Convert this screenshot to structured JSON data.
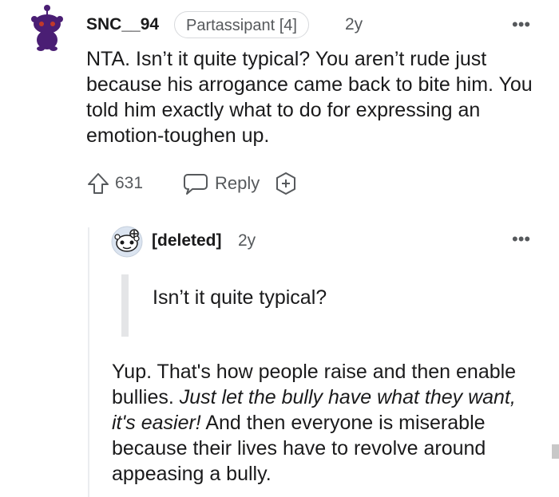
{
  "comment1": {
    "username": "SNC__94",
    "flair": "Partassipant [4]",
    "time": "2y",
    "more": "•••",
    "body": "NTA. Isn’t it quite typical? You aren’t rude just because his arrogance came back to bite him. You told him exactly what to do for expressing an emotion-toughen up.",
    "upvotes": "631",
    "reply_label": "Reply",
    "icons": {
      "avatar": "snoo-avatar-icon",
      "upvote": "upvote-arrow-icon",
      "reply": "reply-bubble-icon",
      "award": "award-plus-icon"
    },
    "colors": {
      "avatar": "#4a1e74",
      "avatar_eyes": "#c0392b"
    }
  },
  "comment2": {
    "username": "[deleted]",
    "time": "2y",
    "more": "•••",
    "quote": "Isn’t it quite typical?",
    "body_part1": "Yup. That's how people raise and then enable bullies. ",
    "body_italic": "Just let the bully have what they want, it's easier!",
    "body_part2": " And then everyone is miserable because their lives have to revolve around appeasing a bully.",
    "icons": {
      "avatar": "deleted-user-snoo-icon"
    }
  }
}
